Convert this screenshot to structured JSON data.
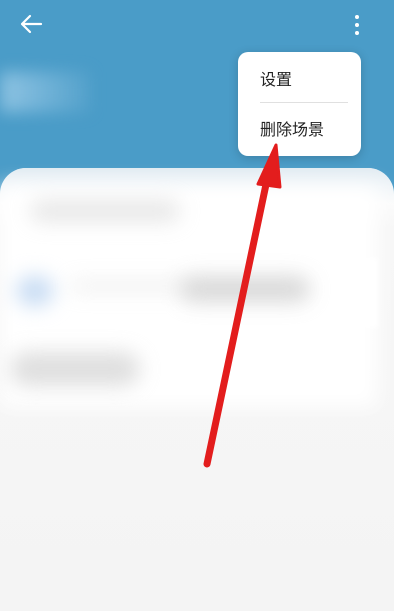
{
  "header": {
    "back_icon": "arrow-left-icon",
    "more_icon": "more-vertical-icon",
    "background_color": "#4a9cc8"
  },
  "menu": {
    "items": [
      {
        "label": "设置"
      },
      {
        "label": "删除场景"
      }
    ]
  },
  "annotation": {
    "arrow_color": "#e31d1d",
    "arrow_icon": "red-arrow-icon"
  }
}
